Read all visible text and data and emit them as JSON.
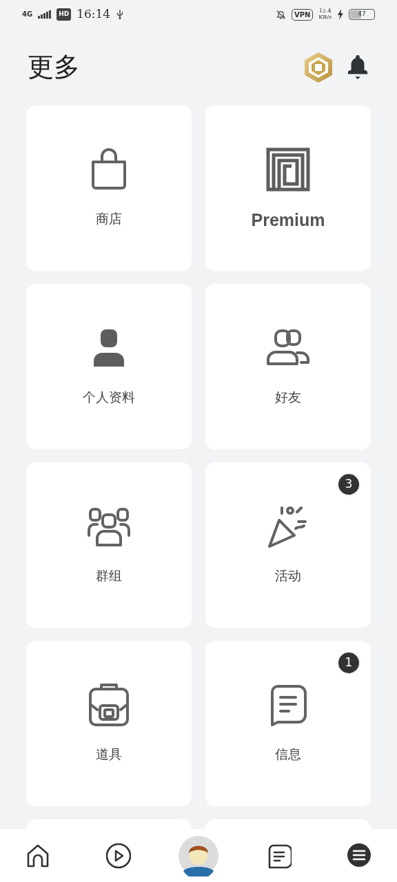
{
  "status_bar": {
    "network": "4G",
    "hd": "HD",
    "time": "16:14",
    "vpn": "VPN",
    "speed": "12.4",
    "speed_unit": "KB/s",
    "battery": "47"
  },
  "header": {
    "title": "更多"
  },
  "tiles": [
    {
      "kind": "shop",
      "label": "商店"
    },
    {
      "kind": "premium",
      "label": "Premium"
    },
    {
      "kind": "profile",
      "label": "个人资料"
    },
    {
      "kind": "friends",
      "label": "好友"
    },
    {
      "kind": "groups",
      "label": "群组"
    },
    {
      "kind": "events",
      "label": "活动",
      "badge": "3"
    },
    {
      "kind": "inventory",
      "label": "道具"
    },
    {
      "kind": "messages",
      "label": "信息",
      "badge": "1"
    }
  ],
  "nav": [
    {
      "kind": "home"
    },
    {
      "kind": "play"
    },
    {
      "kind": "avatar"
    },
    {
      "kind": "chat"
    },
    {
      "kind": "more"
    }
  ]
}
